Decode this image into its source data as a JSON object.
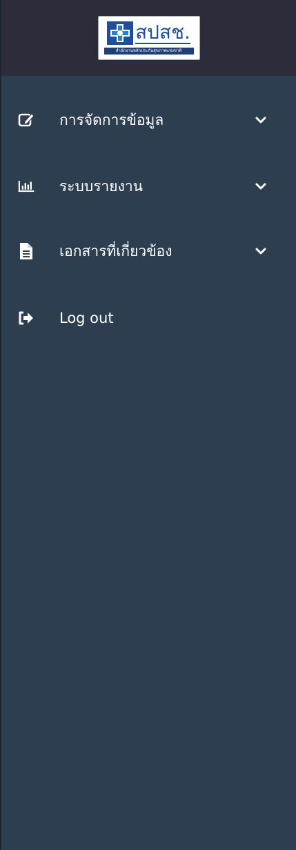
{
  "logo": {
    "name": "สปสช.",
    "subtitle": "สำนักงานหลักประกันสุขภาพแห่งชาติ"
  },
  "colors": {
    "sidebar_bg": "#2c3e50",
    "header_bg": "#2c2c3a",
    "text": "#ffffff",
    "logo_blue": "#1f4f9c"
  },
  "menu": [
    {
      "label": "การจัดการข้อมูล",
      "icon": "edit-icon",
      "has_submenu": true
    },
    {
      "label": "ระบบรายงาน",
      "icon": "bar-chart-icon",
      "has_submenu": true
    },
    {
      "label": "เอกสารที่เกี่ยวข้อง",
      "icon": "document-icon",
      "has_submenu": true
    },
    {
      "label": "Log out",
      "icon": "logout-icon",
      "has_submenu": false
    }
  ]
}
